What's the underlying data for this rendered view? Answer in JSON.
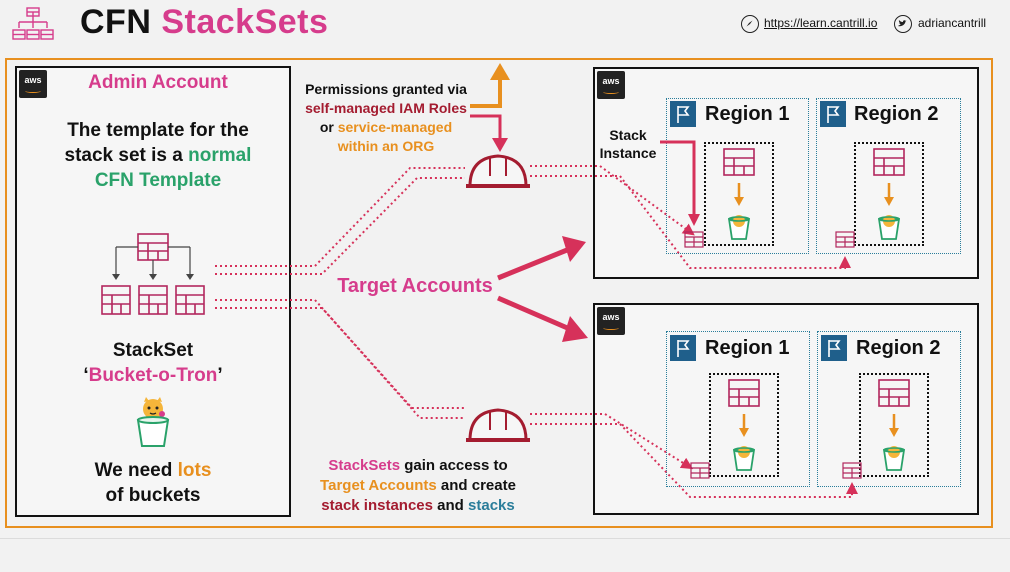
{
  "header": {
    "title_prefix": "CFN",
    "title_main": "StackSets",
    "website": "https://learn.cantrill.io",
    "twitter": "adriancantrill"
  },
  "colors": {
    "pink": "#d63c8c",
    "green": "#2aa26a",
    "orange": "#e8901f",
    "dark_red": "#a41c30",
    "blue": "#2a7d9a",
    "arrow_pink": "#d6315a"
  },
  "icons": [
    "stackset-logo-icon",
    "compass-icon",
    "twitter-icon",
    "aws-logo-icon",
    "region-flag-icon",
    "cfn-template-icon",
    "bucket-icon",
    "hard-hat-icon",
    "arrow-icon"
  ],
  "admin": {
    "aws": "aws",
    "heading": "Admin Account",
    "template_line1": "The template for the",
    "template_line2a": "stack set is a",
    "template_line2b": "normal",
    "template_line3": "CFN Template",
    "stackset_label": "StackSet",
    "stackset_name": "Bucket-o-Tron",
    "quote_open": "‘",
    "quote_close": "’",
    "need_a": "We need",
    "need_b": "lots",
    "need_c": "of buckets"
  },
  "permissions": {
    "line1": "Permissions granted via",
    "line2": "self-managed IAM Roles",
    "line3a": "or",
    "line3b": "service-managed",
    "line4": "within an ORG"
  },
  "target_accounts": "Target Accounts",
  "access": {
    "line1a": "StackSets",
    "line1b": "gain access to",
    "line2a": "Target Accounts",
    "line2b": "and create",
    "line3a": "stack instances",
    "line3b": "and",
    "line3c": "stacks"
  },
  "stack_instance": {
    "line1": "Stack",
    "line2": "Instance"
  },
  "accounts": [
    {
      "aws": "aws",
      "regions": [
        "Region 1",
        "Region 2"
      ]
    },
    {
      "aws": "aws",
      "regions": [
        "Region 1",
        "Region 2"
      ]
    }
  ]
}
